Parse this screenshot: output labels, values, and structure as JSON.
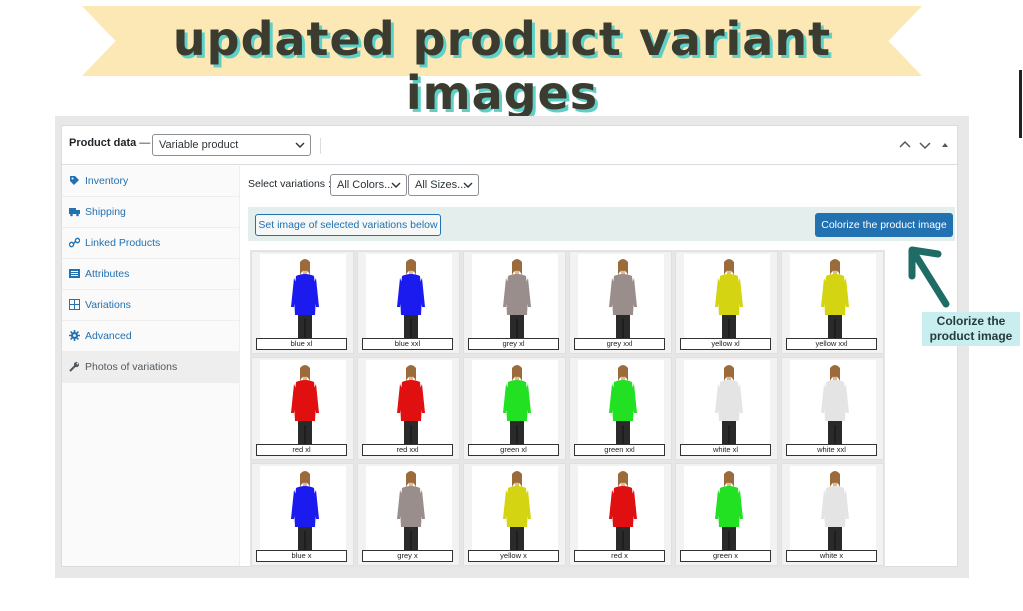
{
  "banner": {
    "title": "updated product variant images"
  },
  "header": {
    "label": "Product data",
    "dash": " —",
    "product_type": "Variable product"
  },
  "sidebar": {
    "items": [
      {
        "label": "Inventory",
        "icon": "tag-icon"
      },
      {
        "label": "Shipping",
        "icon": "truck-icon"
      },
      {
        "label": "Linked Products",
        "icon": "link-icon"
      },
      {
        "label": "Attributes",
        "icon": "list-icon"
      },
      {
        "label": "Variations",
        "icon": "grid-icon"
      },
      {
        "label": "Advanced",
        "icon": "gear-icon"
      },
      {
        "label": "Photos of variations",
        "icon": "wrench-icon"
      }
    ]
  },
  "filters": {
    "label": "Select variations :",
    "colors": "All Colors...",
    "sizes": "All Sizes..."
  },
  "actions": {
    "set_image": "Set image of selected variations below",
    "colorize": "Colorize the product image"
  },
  "variations": [
    {
      "label": "blue xl",
      "color": "#1b1bf0"
    },
    {
      "label": "blue xxl",
      "color": "#1b1bf0"
    },
    {
      "label": "grey xl",
      "color": "#9a8e8c"
    },
    {
      "label": "grey xxl",
      "color": "#9a8e8c"
    },
    {
      "label": "yellow xl",
      "color": "#d4d412"
    },
    {
      "label": "yellow xxl",
      "color": "#d4d412"
    },
    {
      "label": "red xl",
      "color": "#e01010"
    },
    {
      "label": "red xxl",
      "color": "#e01010"
    },
    {
      "label": "green xl",
      "color": "#22e022"
    },
    {
      "label": "green xxl",
      "color": "#22e022"
    },
    {
      "label": "white xl",
      "color": "#e4e4e4"
    },
    {
      "label": "white xxl",
      "color": "#e4e4e4"
    },
    {
      "label": "blue x",
      "color": "#1b1bf0"
    },
    {
      "label": "grey x",
      "color": "#9a8e8c"
    },
    {
      "label": "yellow x",
      "color": "#d4d412"
    },
    {
      "label": "red x",
      "color": "#e01010"
    },
    {
      "label": "green x",
      "color": "#22e022"
    },
    {
      "label": "white x",
      "color": "#e4e4e4"
    }
  ],
  "callout": {
    "line1": "Colorize the",
    "line2": "product image",
    "color": "#1f6b66"
  }
}
